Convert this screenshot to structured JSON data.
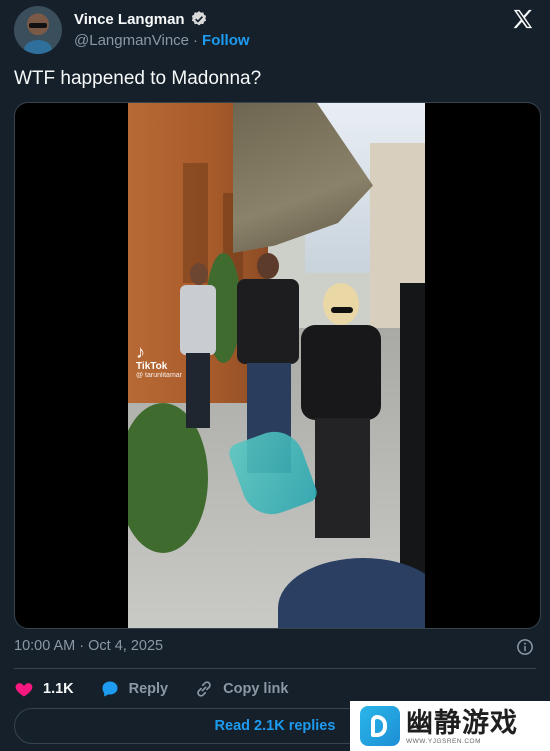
{
  "author": {
    "name": "Vince Langman",
    "handle": "@LangmanVince",
    "separator": "·",
    "follow_label": "Follow"
  },
  "tweet": {
    "text": "WTF happened to Madonna?",
    "timestamp": "10:00 AM · Oct 4, 2025"
  },
  "media": {
    "overlay_brand": "TikTok",
    "overlay_user": "@ tarunlitamar"
  },
  "actions": {
    "like_count": "1.1K",
    "reply_label": "Reply",
    "copy_link_label": "Copy link"
  },
  "replies_button": "Read 2.1K replies",
  "watermark": {
    "text": "幽静游戏",
    "url": "WWW.YJGSREN.COM"
  },
  "colors": {
    "background": "#15202b",
    "accent": "#1d9bf0",
    "like": "#f91880"
  }
}
